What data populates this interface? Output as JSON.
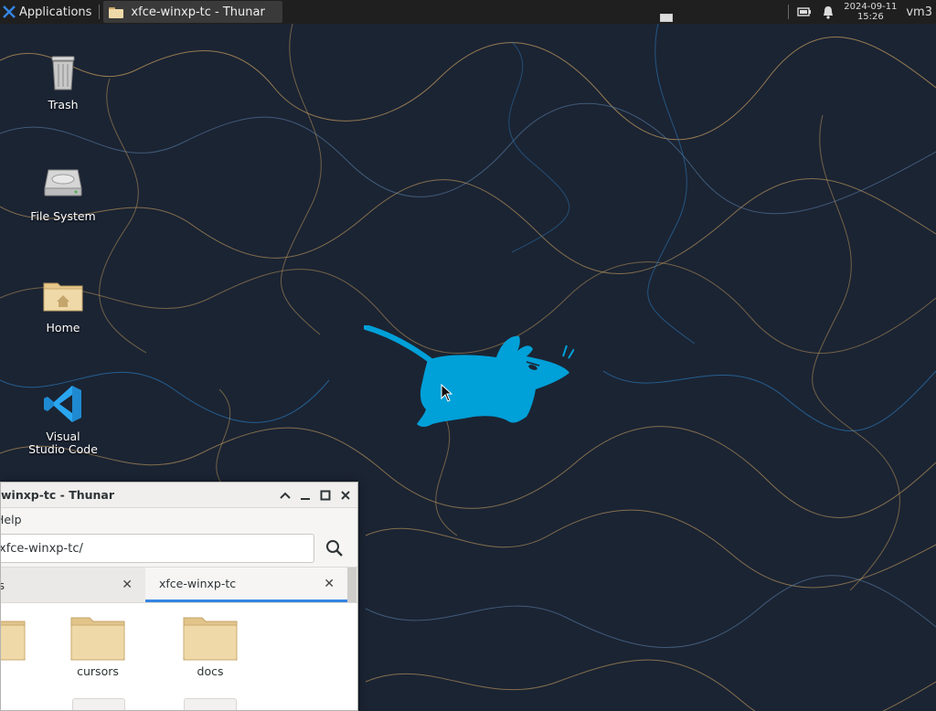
{
  "panel": {
    "applications_label": "Applications",
    "task_title": "xfce-winxp-tc - Thunar",
    "clock_date": "2024-09-11",
    "clock_time": "15:26",
    "user_label": "vm3"
  },
  "desktop_icons": [
    {
      "label": "Trash"
    },
    {
      "label": "File System"
    },
    {
      "label": "Home"
    },
    {
      "label": "Visual Studio Code"
    }
  ],
  "thunar": {
    "title": "winxp-tc - Thunar",
    "menu_help": "Help",
    "location": "xfce-winxp-tc/",
    "tabs": [
      {
        "label": "ls",
        "active": false
      },
      {
        "label": "xfce-winxp-tc",
        "active": true
      }
    ],
    "files": [
      {
        "name": ""
      },
      {
        "name": "cursors"
      },
      {
        "name": "docs"
      }
    ]
  },
  "colors": {
    "panel_bg": "#1f1f1f",
    "desktop_bg": "#1b2433",
    "mascot": "#00a0d8",
    "accent": "#3584e4",
    "folder": "#f0d9a8"
  }
}
